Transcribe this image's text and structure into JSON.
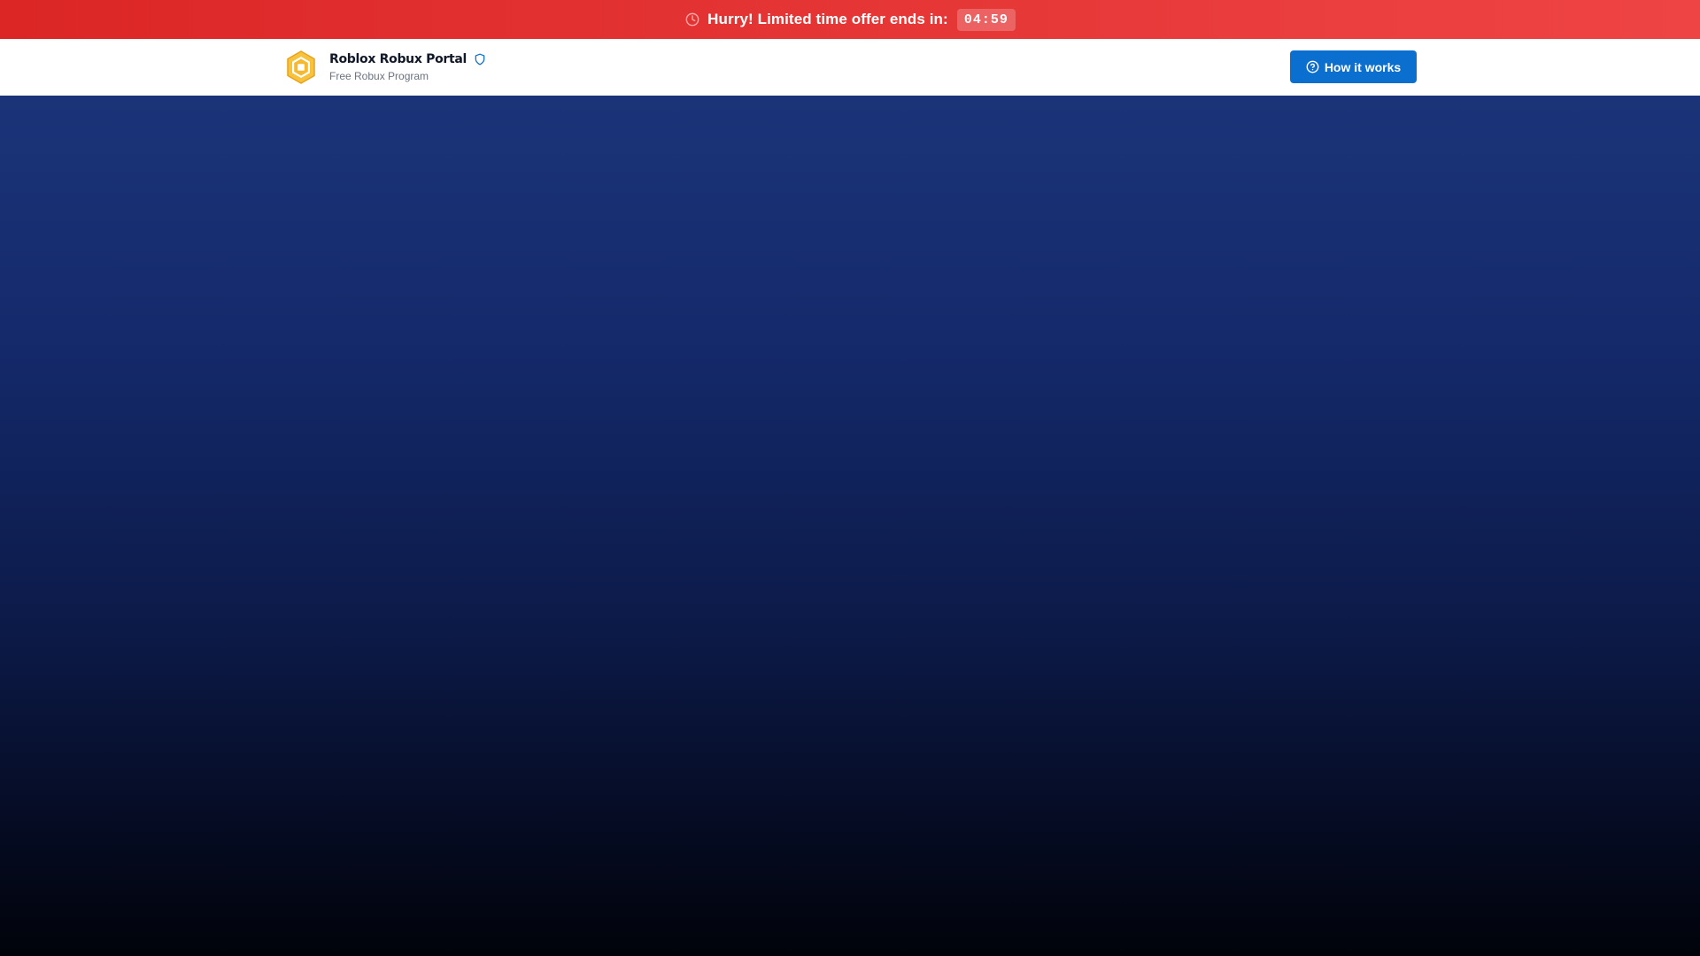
{
  "promo": {
    "text": "Hurry! Limited time offer ends in:",
    "countdown": "04:59",
    "icon": "clock-icon",
    "color": "#dc2626"
  },
  "header": {
    "brand_title": "Roblox Robux Portal",
    "brand_subtitle": "Free Robux Program",
    "logo_icon": "robux-hexagon-icon",
    "verified_icon": "shield-icon",
    "logo_color": "#f5b82e",
    "how_button_label": "How it works",
    "how_button_icon": "question-circle-icon",
    "accent": "#0b6fd0"
  },
  "hero": {
    "gradient_top": "#1b3479",
    "gradient_bottom": "#01030a"
  }
}
